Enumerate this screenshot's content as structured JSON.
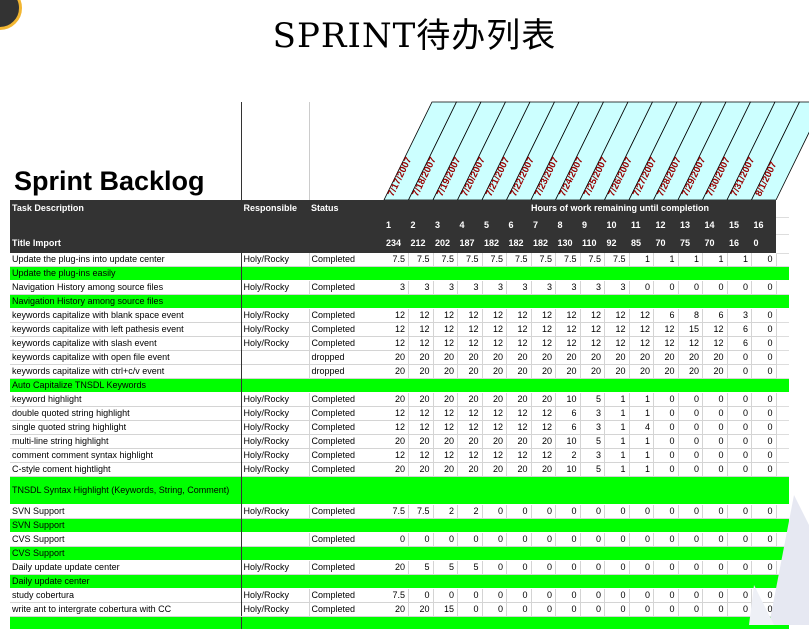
{
  "slide_title": "SPRINT待办列表",
  "sheet_title": "Sprint Backlog",
  "colors": {
    "story_row": "#00ff00",
    "header_bg": "#333333",
    "date_bg": "#ccffff",
    "date_text": "#990000"
  },
  "dates": [
    "7/17/2007",
    "7/18/2007",
    "7/19/2007",
    "7/20/2007",
    "7/21/2007",
    "7/22/2007",
    "7/23/2007",
    "7/24/2007",
    "7/25/2007",
    "7/26/2007",
    "7/27/2007",
    "7/28/2007",
    "7/29/2007",
    "7/30/2007",
    "7/31/2007",
    "8/1/2007"
  ],
  "header": {
    "task_description": "Task Description",
    "responsible": "Responsible",
    "status": "Status",
    "hours_label": "Hours of work remaining until completion",
    "title_import": "Title Import",
    "day_numbers": [
      "1",
      "2",
      "3",
      "4",
      "5",
      "6",
      "7",
      "8",
      "9",
      "10",
      "11",
      "12",
      "13",
      "14",
      "15",
      "16"
    ],
    "totals": [
      "234",
      "212",
      "202",
      "187",
      "182",
      "182",
      "182",
      "130",
      "110",
      "92",
      "85",
      "70",
      "75",
      "70",
      "16",
      "0"
    ]
  },
  "rows": [
    {
      "type": "task",
      "task": "Update the plug-ins into update center",
      "responsible": "Holy/Rocky",
      "status": "Completed",
      "hours": [
        "7.5",
        "7.5",
        "7.5",
        "7.5",
        "7.5",
        "7.5",
        "7.5",
        "7.5",
        "7.5",
        "7.5",
        "1",
        "1",
        "1",
        "1",
        "1",
        "0"
      ]
    },
    {
      "type": "story",
      "task": "Update the plug-ins easily"
    },
    {
      "type": "task",
      "task": "Navigation History among source files",
      "responsible": "Holy/Rocky",
      "status": "Completed",
      "hours": [
        "3",
        "3",
        "3",
        "3",
        "3",
        "3",
        "3",
        "3",
        "3",
        "3",
        "0",
        "0",
        "0",
        "0",
        "0",
        "0"
      ]
    },
    {
      "type": "story",
      "task": "Navigation History among source files"
    },
    {
      "type": "task",
      "task": "keywords capitalize with blank space event",
      "responsible": "Holy/Rocky",
      "status": "Completed",
      "hours": [
        "12",
        "12",
        "12",
        "12",
        "12",
        "12",
        "12",
        "12",
        "12",
        "12",
        "12",
        "6",
        "8",
        "6",
        "3",
        "0"
      ]
    },
    {
      "type": "task",
      "task": "keywords capitalize with left pathesis event",
      "responsible": "Holy/Rocky",
      "status": "Completed",
      "hours": [
        "12",
        "12",
        "12",
        "12",
        "12",
        "12",
        "12",
        "12",
        "12",
        "12",
        "12",
        "12",
        "15",
        "12",
        "6",
        "0"
      ]
    },
    {
      "type": "task",
      "task": "keywords capitalize with slash event",
      "responsible": "Holy/Rocky",
      "status": "Completed",
      "hours": [
        "12",
        "12",
        "12",
        "12",
        "12",
        "12",
        "12",
        "12",
        "12",
        "12",
        "12",
        "12",
        "12",
        "12",
        "6",
        "0"
      ]
    },
    {
      "type": "task",
      "task": "keywords capitalize with open file event",
      "responsible": "",
      "status": "dropped",
      "hours": [
        "20",
        "20",
        "20",
        "20",
        "20",
        "20",
        "20",
        "20",
        "20",
        "20",
        "20",
        "20",
        "20",
        "20",
        "0",
        "0"
      ]
    },
    {
      "type": "task",
      "task": "keywords capitalize with ctrl+c/v event",
      "responsible": "",
      "status": "dropped",
      "hours": [
        "20",
        "20",
        "20",
        "20",
        "20",
        "20",
        "20",
        "20",
        "20",
        "20",
        "20",
        "20",
        "20",
        "20",
        "0",
        "0"
      ]
    },
    {
      "type": "story",
      "task": "Auto Capitalize TNSDL Keywords"
    },
    {
      "type": "task",
      "task": "keyword highlight",
      "responsible": "Holy/Rocky",
      "status": "Completed",
      "hours": [
        "20",
        "20",
        "20",
        "20",
        "20",
        "20",
        "20",
        "10",
        "5",
        "1",
        "1",
        "0",
        "0",
        "0",
        "0",
        "0"
      ]
    },
    {
      "type": "task",
      "task": "double quoted string highlight",
      "responsible": "Holy/Rocky",
      "status": "Completed",
      "hours": [
        "12",
        "12",
        "12",
        "12",
        "12",
        "12",
        "12",
        "6",
        "3",
        "1",
        "1",
        "0",
        "0",
        "0",
        "0",
        "0"
      ]
    },
    {
      "type": "task",
      "task": "single quoted string highlight",
      "responsible": "Holy/Rocky",
      "status": "Completed",
      "hours": [
        "12",
        "12",
        "12",
        "12",
        "12",
        "12",
        "12",
        "6",
        "3",
        "1",
        "4",
        "0",
        "0",
        "0",
        "0",
        "0"
      ]
    },
    {
      "type": "task",
      "task": "multi-line string highlight",
      "responsible": "Holy/Rocky",
      "status": "Completed",
      "hours": [
        "20",
        "20",
        "20",
        "20",
        "20",
        "20",
        "20",
        "10",
        "5",
        "1",
        "1",
        "0",
        "0",
        "0",
        "0",
        "0"
      ]
    },
    {
      "type": "task",
      "task": "comment comment syntax highlight",
      "responsible": "Holy/Rocky",
      "status": "Completed",
      "hours": [
        "12",
        "12",
        "12",
        "12",
        "12",
        "12",
        "12",
        "2",
        "3",
        "1",
        "1",
        "0",
        "0",
        "0",
        "0",
        "0"
      ]
    },
    {
      "type": "task",
      "task": "C-style coment hightlight",
      "responsible": "Holy/Rocky",
      "status": "Completed",
      "hours": [
        "20",
        "20",
        "20",
        "20",
        "20",
        "20",
        "20",
        "10",
        "5",
        "1",
        "1",
        "0",
        "0",
        "0",
        "0",
        "0"
      ]
    },
    {
      "type": "story2",
      "task": "TNSDL Syntax Highlight (Keywords, String, Comment)"
    },
    {
      "type": "task",
      "task": "SVN Support",
      "responsible": "Holy/Rocky",
      "status": "Completed",
      "hours": [
        "7.5",
        "7.5",
        "2",
        "2",
        "0",
        "0",
        "0",
        "0",
        "0",
        "0",
        "0",
        "0",
        "0",
        "0",
        "0",
        "0"
      ]
    },
    {
      "type": "story",
      "task": "SVN Support"
    },
    {
      "type": "task",
      "task": "CVS Support",
      "responsible": "",
      "status": "Completed",
      "hours": [
        "0",
        "0",
        "0",
        "0",
        "0",
        "0",
        "0",
        "0",
        "0",
        "0",
        "0",
        "0",
        "0",
        "0",
        "0",
        "0"
      ]
    },
    {
      "type": "story",
      "task": "CVS Support"
    },
    {
      "type": "task",
      "task": "Daily update update center",
      "responsible": "Holy/Rocky",
      "status": "Completed",
      "hours": [
        "20",
        "5",
        "5",
        "5",
        "0",
        "0",
        "0",
        "0",
        "0",
        "0",
        "0",
        "0",
        "0",
        "0",
        "0",
        "0"
      ]
    },
    {
      "type": "story",
      "task": "Daily update center"
    },
    {
      "type": "task",
      "task": "study cobertura",
      "responsible": "Holy/Rocky",
      "status": "Completed",
      "hours": [
        "7.5",
        "0",
        "0",
        "0",
        "0",
        "0",
        "0",
        "0",
        "0",
        "0",
        "0",
        "0",
        "0",
        "0",
        "0",
        "0"
      ]
    },
    {
      "type": "task",
      "task": "write ant to intergrate cobertura with CC",
      "responsible": "Holy/Rocky",
      "status": "Completed",
      "hours": [
        "20",
        "20",
        "15",
        "0",
        "0",
        "0",
        "0",
        "0",
        "0",
        "0",
        "0",
        "0",
        "0",
        "0",
        "0",
        "0"
      ]
    },
    {
      "type": "story",
      "task": ""
    }
  ]
}
